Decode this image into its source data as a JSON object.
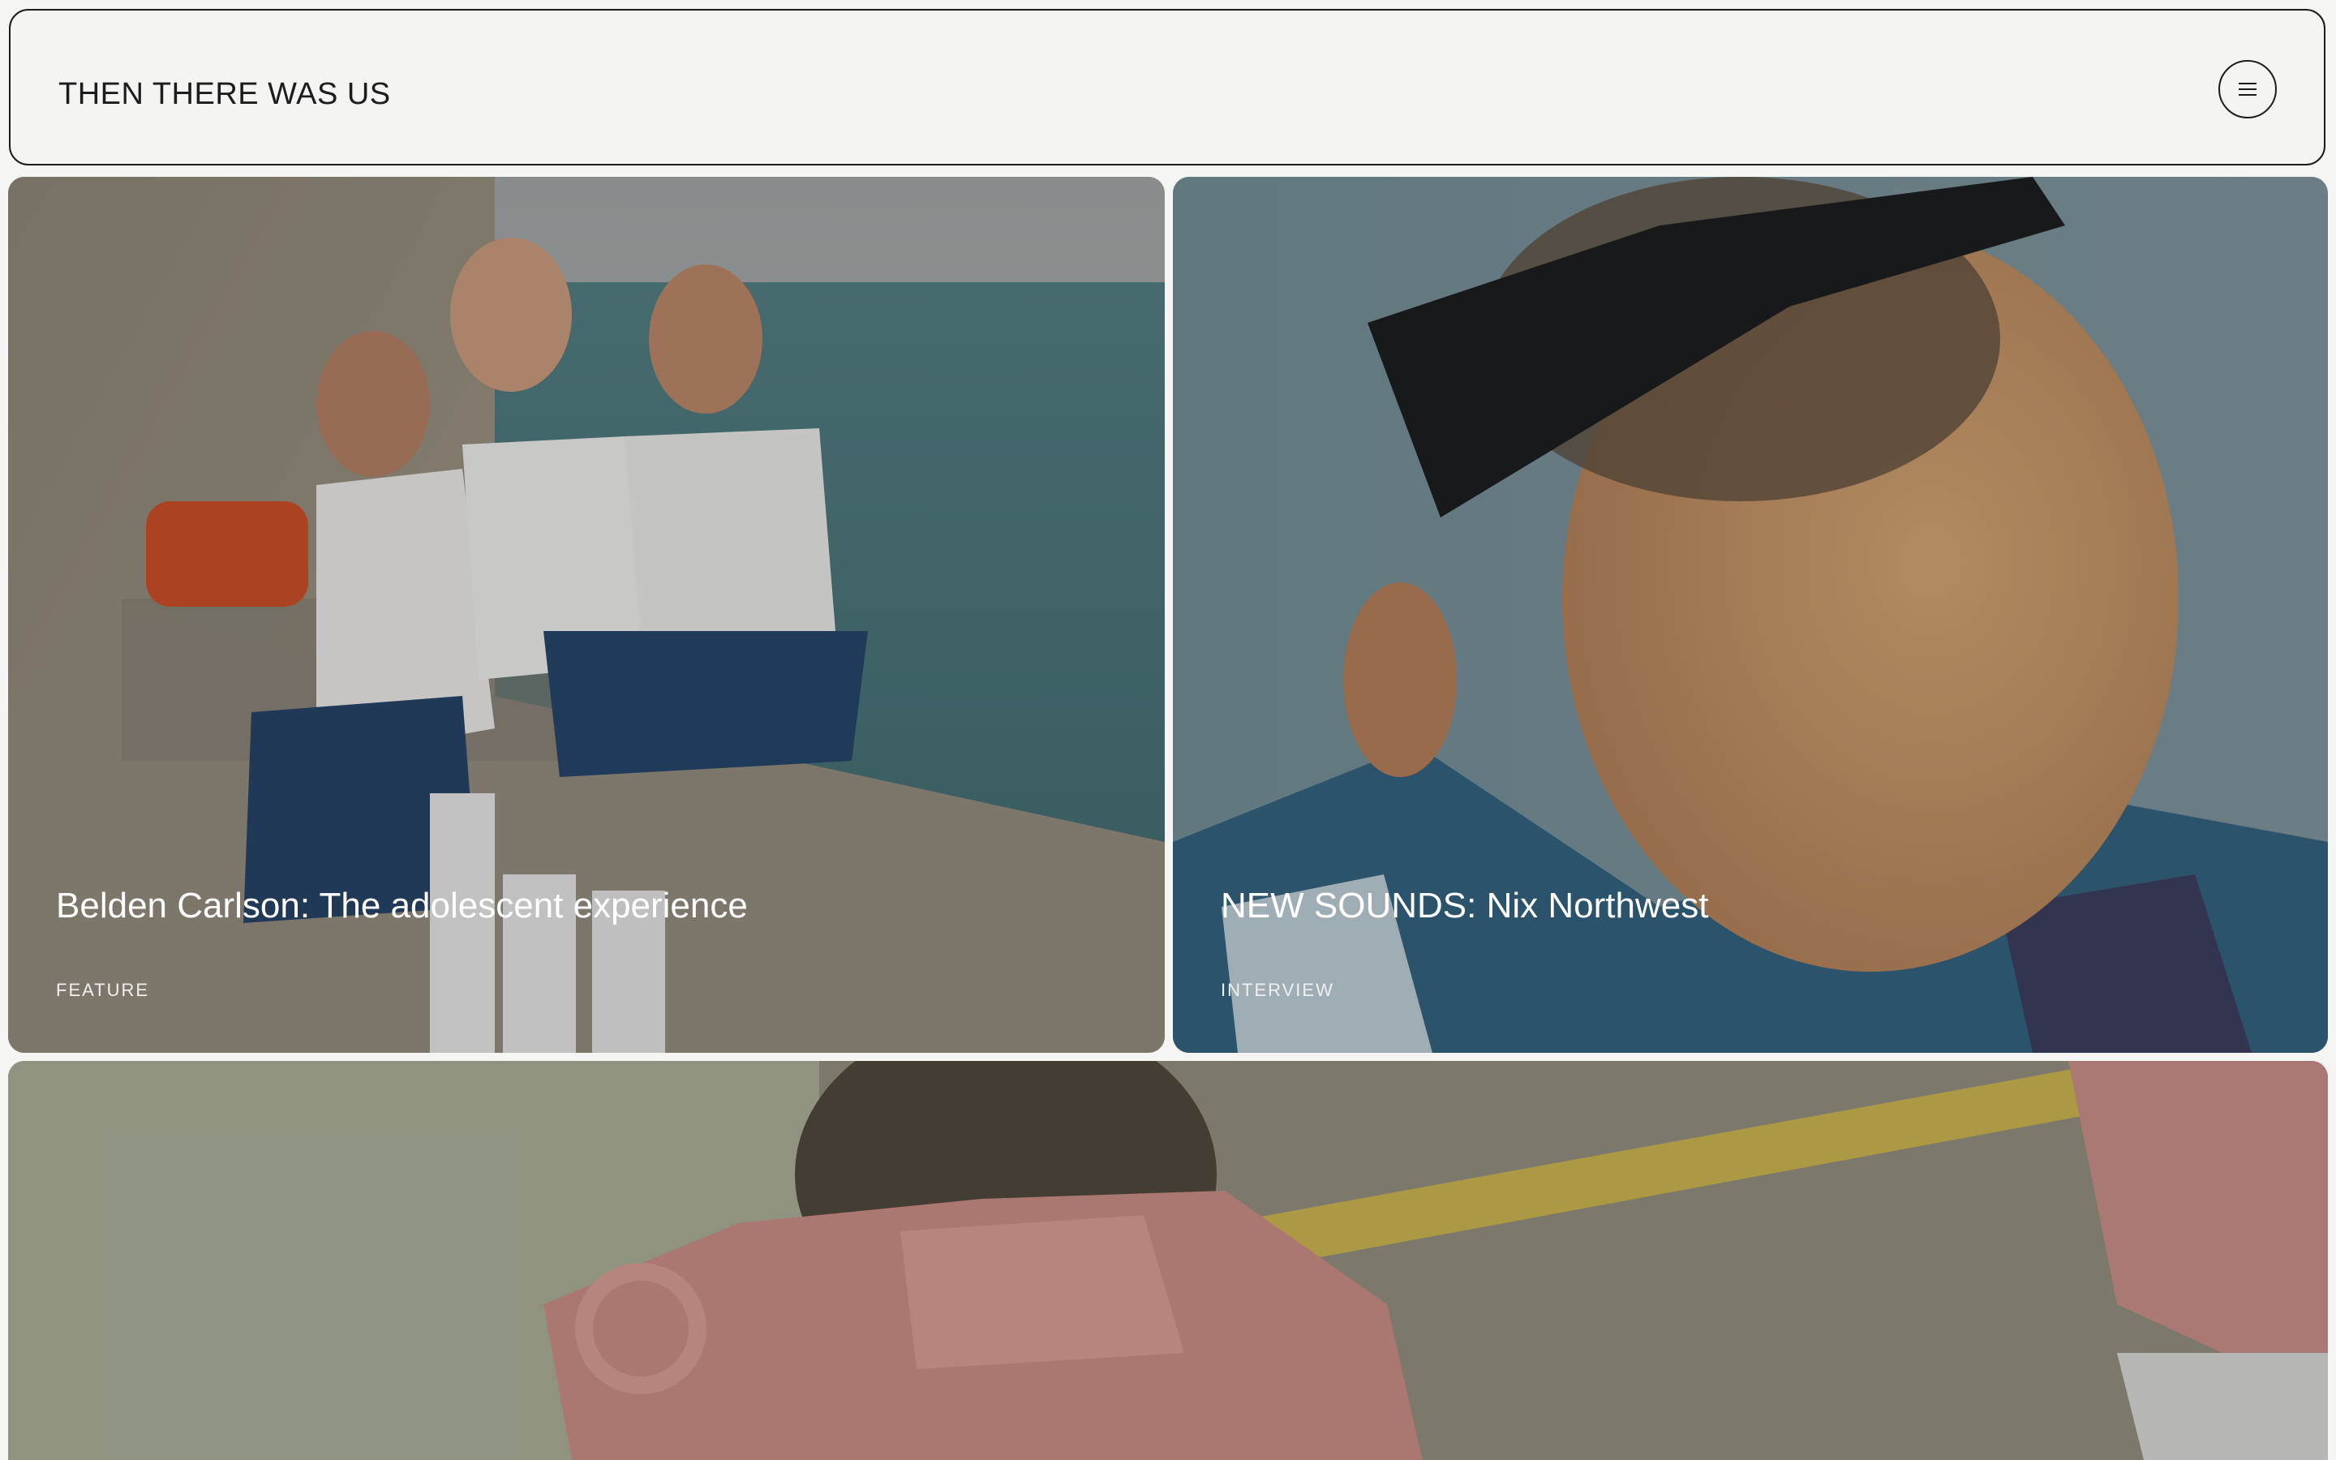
{
  "header": {
    "site_title": "THEN THERE WAS US",
    "menu_icon": "hamburger-menu-icon"
  },
  "cards": [
    {
      "title": "Belden Carlson: The adolescent experience",
      "tag": "FEATURE"
    },
    {
      "title": "NEW SOUNDS: Nix Northwest",
      "tag": "INTERVIEW"
    },
    {
      "title": "",
      "tag": ""
    }
  ],
  "colors": {
    "background": "#f5f5f4",
    "border": "#1b1b1b",
    "card_text": "#ffffff"
  }
}
